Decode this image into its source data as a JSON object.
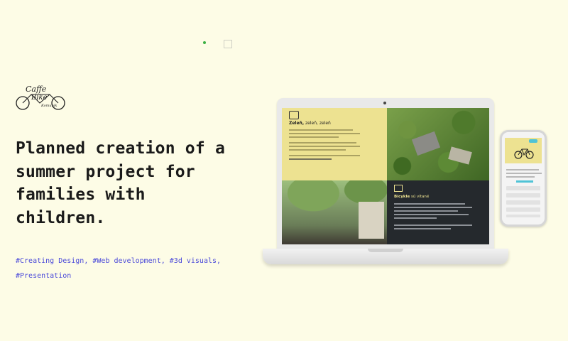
{
  "brand": {
    "logo_word_1": "Caffe",
    "logo_word_2": "Bike",
    "logo_word_3": "Komunik"
  },
  "hero": {
    "headline_lines": [
      "Planned creation of a",
      "summer project for",
      "families with",
      "children."
    ],
    "tags": [
      "#Creating Design,",
      "#Web development,",
      "#3d visuals,",
      "#Presentation"
    ]
  },
  "mockup": {
    "screen_title_bold": "Zeleň,",
    "screen_title_rest": " zeleň, zeleň",
    "dark_title_bold": "Bicykle",
    "dark_title_rest": " sú vítané"
  },
  "colors": {
    "background": "#fdfce6",
    "tag_text": "#4b4ad9",
    "accent_yellow": "#ede291",
    "dark_panel": "#25292d",
    "indicator_dot": "#3cb043"
  }
}
